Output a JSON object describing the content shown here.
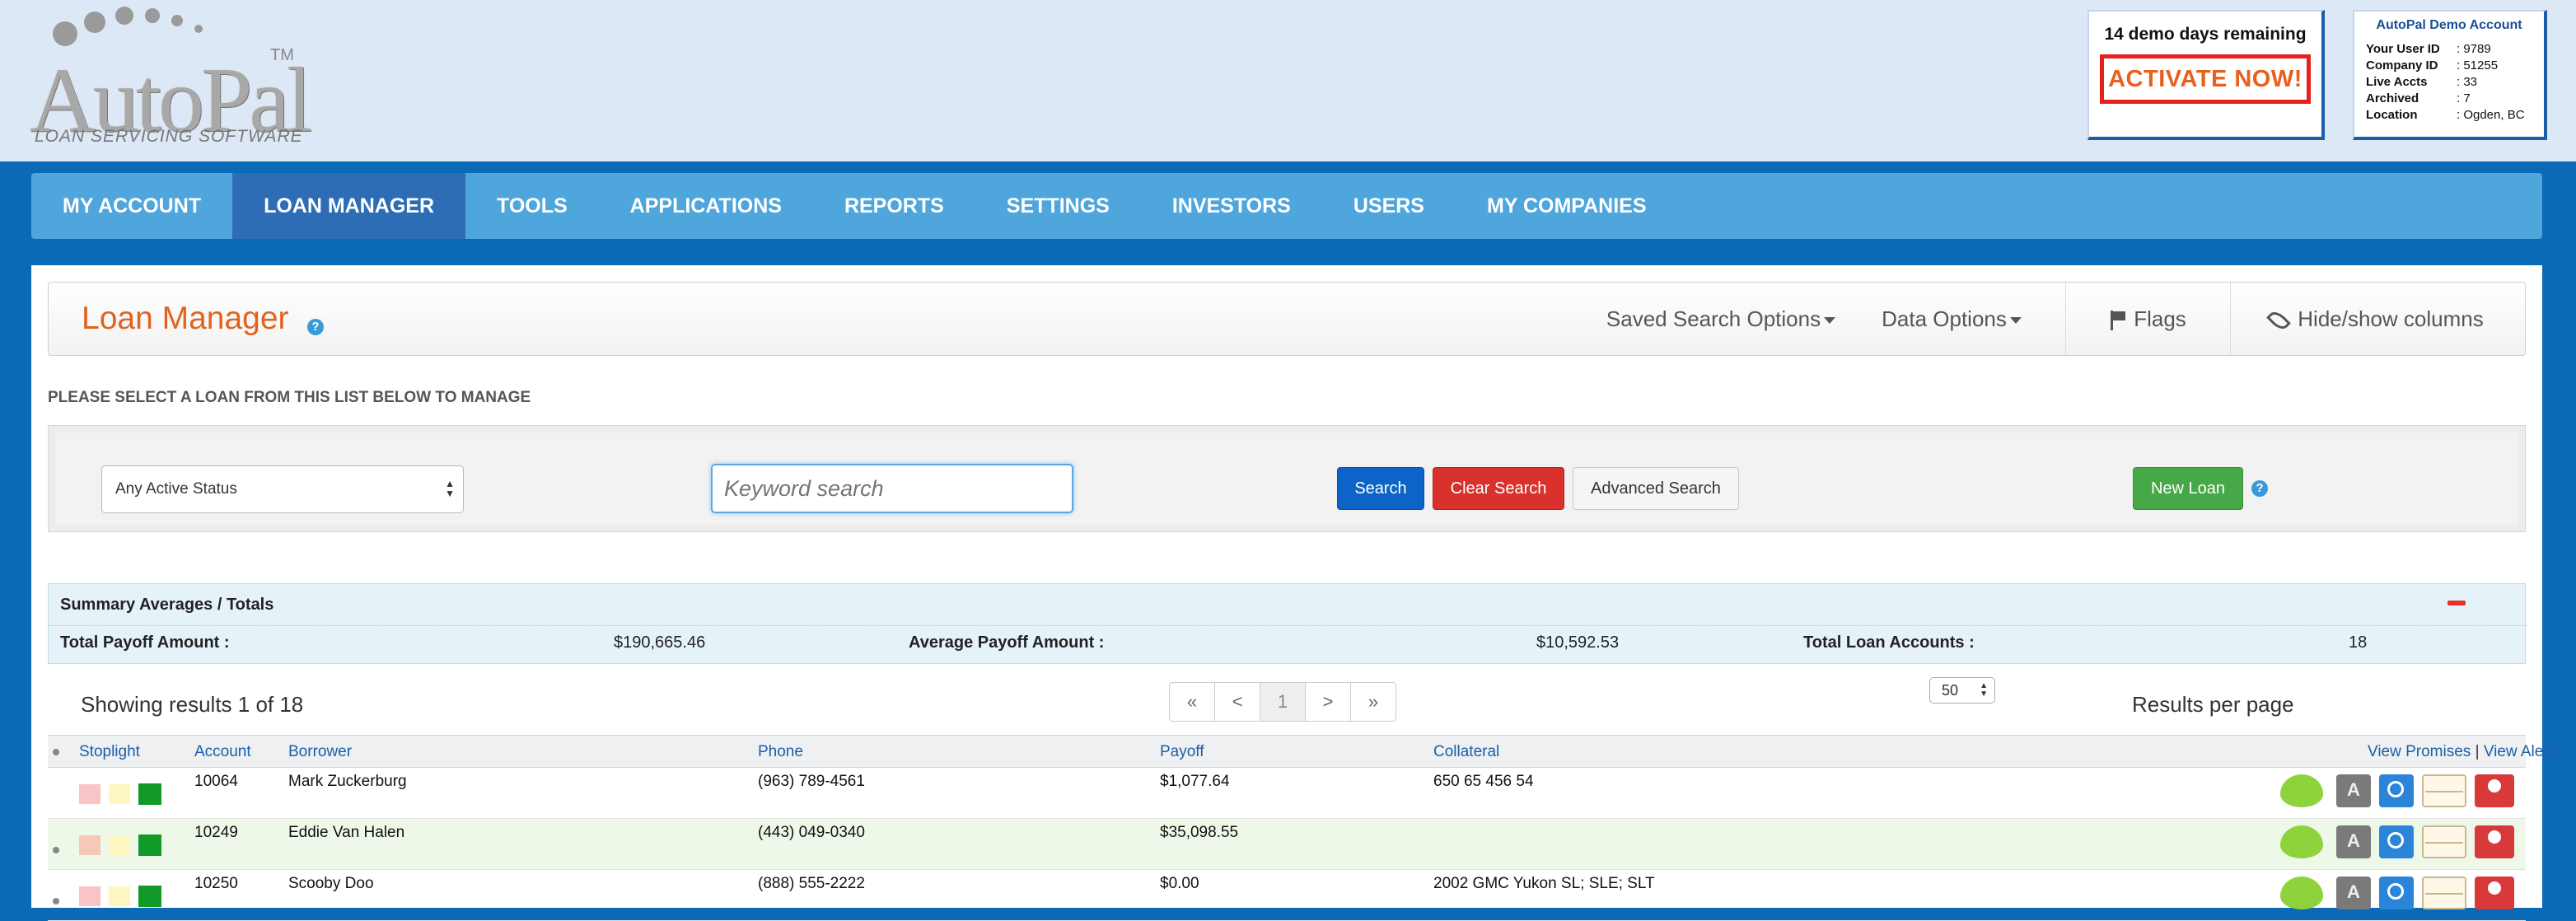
{
  "logo": {
    "name": "AutoPal",
    "trademark": "TM",
    "tagline": "LOAN SERVICING SOFTWARE"
  },
  "demo": {
    "text": "14 demo days remaining",
    "activate_label": "ACTIVATE NOW!"
  },
  "account": {
    "title": "AutoPal Demo Account",
    "rows": [
      {
        "label": "Your User ID",
        "value": ": 9789"
      },
      {
        "label": "Company ID",
        "value": ": 51255"
      },
      {
        "label": "Live Accts",
        "value": ": 33"
      },
      {
        "label": "Archived",
        "value": ": 7"
      },
      {
        "label": "Location",
        "value": ": Ogden, BC"
      }
    ]
  },
  "nav": {
    "items": [
      {
        "label": "MY ACCOUNT"
      },
      {
        "label": "LOAN MANAGER"
      },
      {
        "label": "TOOLS"
      },
      {
        "label": "APPLICATIONS"
      },
      {
        "label": "REPORTS"
      },
      {
        "label": "SETTINGS"
      },
      {
        "label": "INVESTORS"
      },
      {
        "label": "USERS"
      },
      {
        "label": "MY COMPANIES"
      }
    ],
    "active": "LOAN MANAGER"
  },
  "page": {
    "title": "Loan Manager",
    "help": "?",
    "toolbar": {
      "saved_search": "Saved Search Options",
      "data_options": "Data Options",
      "flags": "Flags",
      "hide_show": "Hide/show columns"
    },
    "instruction": "PLEASE SELECT A LOAN FROM THIS LIST BELOW TO MANAGE"
  },
  "filters": {
    "status_value": "Any Active Status",
    "keyword_placeholder": "Keyword search",
    "search_label": "Search",
    "clear_label": "Clear Search",
    "advanced_label": "Advanced Search",
    "new_loan_label": "New Loan",
    "help": "?"
  },
  "summary": {
    "title": "Summary Averages / Totals",
    "total_payoff_label": "Total Payoff Amount :",
    "total_payoff_value": "$190,665.46",
    "avg_payoff_label": "Average Payoff Amount :",
    "avg_payoff_value": "$10,592.53",
    "total_accounts_label": "Total Loan Accounts :",
    "total_accounts_value": "18"
  },
  "results": {
    "showing": "Showing results 1 of 18",
    "pager": [
      "«",
      "<",
      "1",
      ">",
      "»"
    ],
    "per_page_value": "50",
    "per_page_label": "Results per page"
  },
  "grid": {
    "columns": {
      "stoplight": "Stoplight",
      "account": "Account",
      "borrower": "Borrower",
      "phone": "Phone",
      "payoff": "Payoff",
      "collateral": "Collateral"
    },
    "view_promises": "View Promises",
    "separator": "|",
    "view_alerts": "View Alerts",
    "rows": [
      {
        "account": "10064",
        "borrower": "Mark Zuckerburg",
        "phone": "(963) 789-4561",
        "payoff": "$1,077.64",
        "collateral": "650 65 456 54"
      },
      {
        "account": "10249",
        "borrower": "Eddie Van Halen",
        "phone": "(443) 049-0340",
        "payoff": "$35,098.55",
        "collateral": ""
      },
      {
        "account": "10250",
        "borrower": "Scooby Doo",
        "phone": "(888) 555-2222",
        "payoff": "$0.00",
        "collateral": "2002 GMC Yukon SL; SLE; SLT"
      }
    ]
  },
  "colors": {
    "brand_blue": "#0a6ab8",
    "nav_blue": "#4fa6dc",
    "nav_active": "#2d6db5",
    "title_orange": "#e0641e",
    "activate_red": "#e8201d"
  }
}
